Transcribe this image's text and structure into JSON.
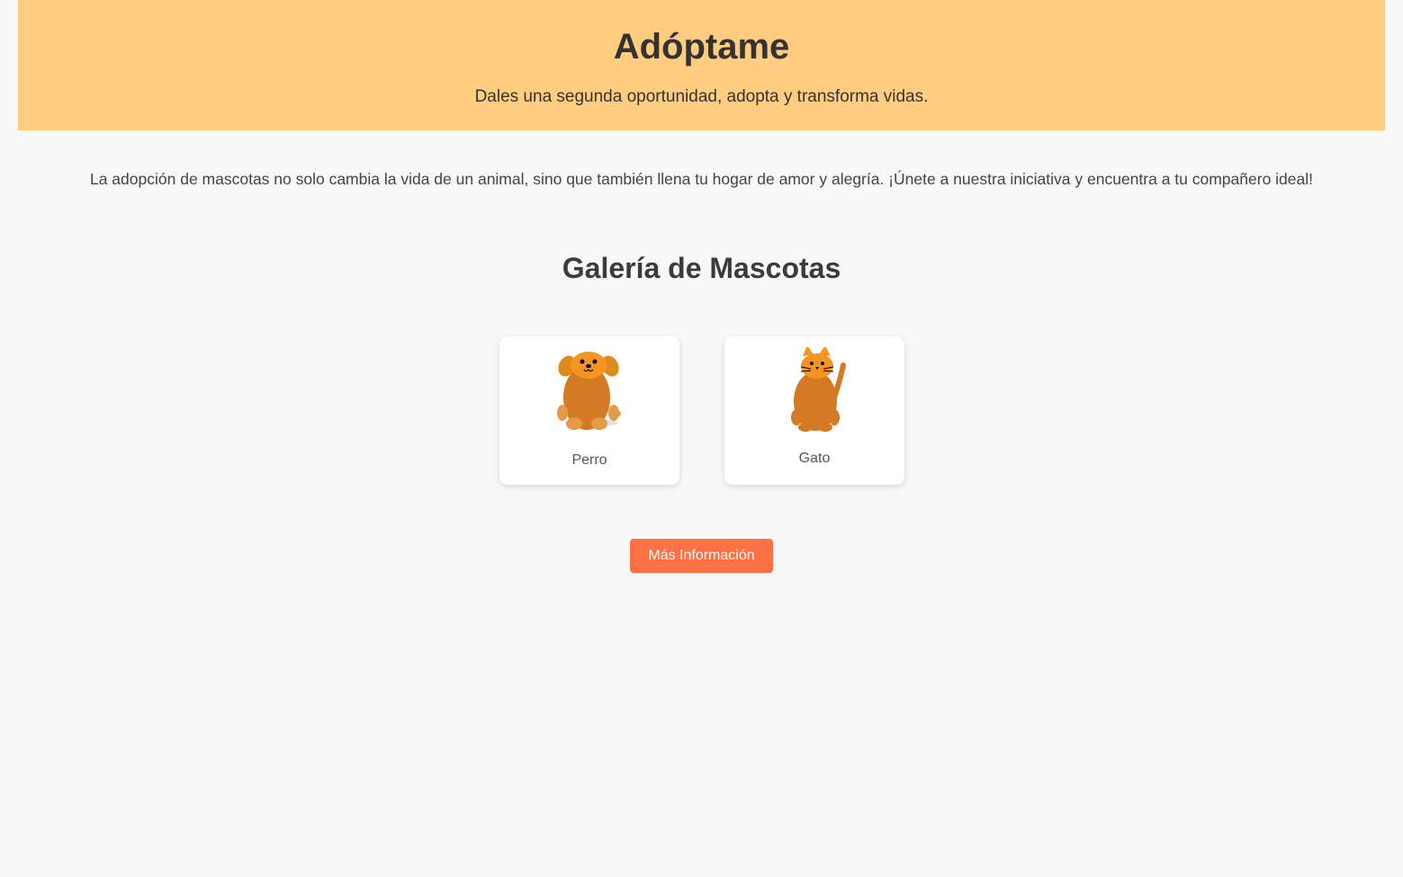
{
  "header": {
    "title": "Adóptame",
    "subtitle": "Dales una segunda oportunidad, adopta y transforma vidas."
  },
  "intro": "La adopción de mascotas no solo cambia la vida de un animal, sino que también llena tu hogar de amor y alegría. ¡Únete a nuestra iniciativa y encuentra a tu compañero ideal!",
  "gallery": {
    "title": "Galería de Mascotas",
    "pets": [
      {
        "name": "Perro",
        "icon": "dog-icon"
      },
      {
        "name": "Gato",
        "icon": "cat-icon"
      }
    ]
  },
  "actions": {
    "more_info_label": "Más Información"
  },
  "colors": {
    "header_bg": "#ffcc80",
    "page_bg": "#f8f8f8",
    "button_bg": "#ff7043",
    "pet_body": "#d47a24",
    "pet_head": "#f5941e"
  }
}
